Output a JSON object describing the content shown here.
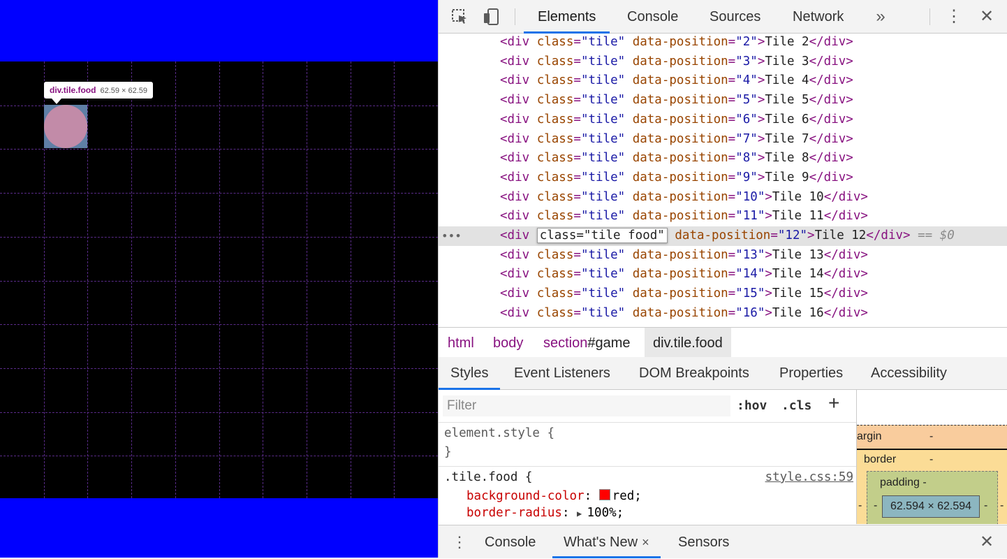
{
  "inspected_page": {
    "tooltip": {
      "name": "div.tile.food",
      "size": "62.59 × 62.59"
    }
  },
  "devtools": {
    "toolbar": {
      "tabs": [
        "Elements",
        "Console",
        "Sources",
        "Network"
      ],
      "more_tabs_icon": "chevron-double-right",
      "menu_icon": "kebab",
      "close_icon": "close"
    },
    "dom_lines": [
      {
        "open": "<div",
        "attr": "class",
        "value": "\"tile\"",
        "attr2": "data-position",
        "value2": "\"2\"",
        "text": "Tile 2",
        "close": "</div>"
      },
      {
        "open": "<div",
        "attr": "class",
        "value": "\"tile\"",
        "attr2": "data-position",
        "value2": "\"3\"",
        "text": "Tile 3",
        "close": "</div>"
      },
      {
        "open": "<div",
        "attr": "class",
        "value": "\"tile\"",
        "attr2": "data-position",
        "value2": "\"4\"",
        "text": "Tile 4",
        "close": "</div>"
      },
      {
        "open": "<div",
        "attr": "class",
        "value": "\"tile\"",
        "attr2": "data-position",
        "value2": "\"5\"",
        "text": "Tile 5",
        "close": "</div>"
      },
      {
        "open": "<div",
        "attr": "class",
        "value": "\"tile\"",
        "attr2": "data-position",
        "value2": "\"6\"",
        "text": "Tile 6",
        "close": "</div>"
      },
      {
        "open": "<div",
        "attr": "class",
        "value": "\"tile\"",
        "attr2": "data-position",
        "value2": "\"7\"",
        "text": "Tile 7",
        "close": "</div>"
      },
      {
        "open": "<div",
        "attr": "class",
        "value": "\"tile\"",
        "attr2": "data-position",
        "value2": "\"8\"",
        "text": "Tile 8",
        "close": "</div>"
      },
      {
        "open": "<div",
        "attr": "class",
        "value": "\"tile\"",
        "attr2": "data-position",
        "value2": "\"9\"",
        "text": "Tile 9",
        "close": "</div>"
      },
      {
        "open": "<div",
        "attr": "class",
        "value": "\"tile\"",
        "attr2": "data-position",
        "value2": "\"10\"",
        "text": "Tile 10",
        "close": "</div>"
      },
      {
        "open": "<div",
        "attr": "class",
        "value": "\"tile\"",
        "attr2": "data-position",
        "value2": "\"11\"",
        "text": "Tile 11",
        "close": "</div>"
      },
      {
        "open": "<div",
        "attr": "class=\"tile food\"",
        "attr2": "data-position",
        "value2": "\"12\"",
        "text": "Tile 12",
        "close": "</div>",
        "selected": true,
        "suffix": "== $0"
      },
      {
        "open": "<div",
        "attr": "class",
        "value": "\"tile\"",
        "attr2": "data-position",
        "value2": "\"13\"",
        "text": "Tile 13",
        "close": "</div>"
      },
      {
        "open": "<div",
        "attr": "class",
        "value": "\"tile\"",
        "attr2": "data-position",
        "value2": "\"14\"",
        "text": "Tile 14",
        "close": "</div>"
      },
      {
        "open": "<div",
        "attr": "class",
        "value": "\"tile\"",
        "attr2": "data-position",
        "value2": "\"15\"",
        "text": "Tile 15",
        "close": "</div>"
      },
      {
        "open": "<div",
        "attr": "class",
        "value": "\"tile\"",
        "attr2": "data-position",
        "value2": "\"16\"",
        "text": "Tile 16",
        "close": "</div>"
      }
    ],
    "selected_dots": "•••",
    "breadcrumbs": [
      {
        "tag": "html",
        "id": ""
      },
      {
        "tag": "body",
        "id": ""
      },
      {
        "tag": "section",
        "id": "#game"
      },
      {
        "tag": "div.tile.food",
        "id": "",
        "active": true
      }
    ],
    "sub_tabs": [
      "Styles",
      "Event Listeners",
      "DOM Breakpoints",
      "Properties",
      "Accessibility"
    ],
    "styles": {
      "filter_placeholder": "Filter",
      "hov_button": ":hov",
      "cls_button": ".cls",
      "add_button": "+",
      "element_style_selector": "element.style {",
      "element_style_close": "}",
      "rule_selector": ".tile.food {",
      "rule_source": "style.css:59",
      "declarations": [
        {
          "prop": "background-color",
          "value": "red;",
          "swatch": "#ff0000"
        },
        {
          "prop": "border-radius",
          "value": "100%;",
          "expandable": true
        }
      ]
    },
    "box_model": {
      "margin_label": "argin",
      "margin_value": "-",
      "border_label": "border",
      "border_value": "-",
      "padding_label": "padding -",
      "side_dash": "-",
      "content_size": "62.594 × 62.594"
    },
    "drawer": {
      "tabs": [
        "Console",
        "What's New",
        "Sensors"
      ],
      "active_close": "×",
      "close_icon": "close"
    }
  },
  "colors": {
    "page_band": "#0000ff",
    "game_bg": "#000000",
    "food": "#ff0000",
    "accent": "#1a73e8"
  }
}
